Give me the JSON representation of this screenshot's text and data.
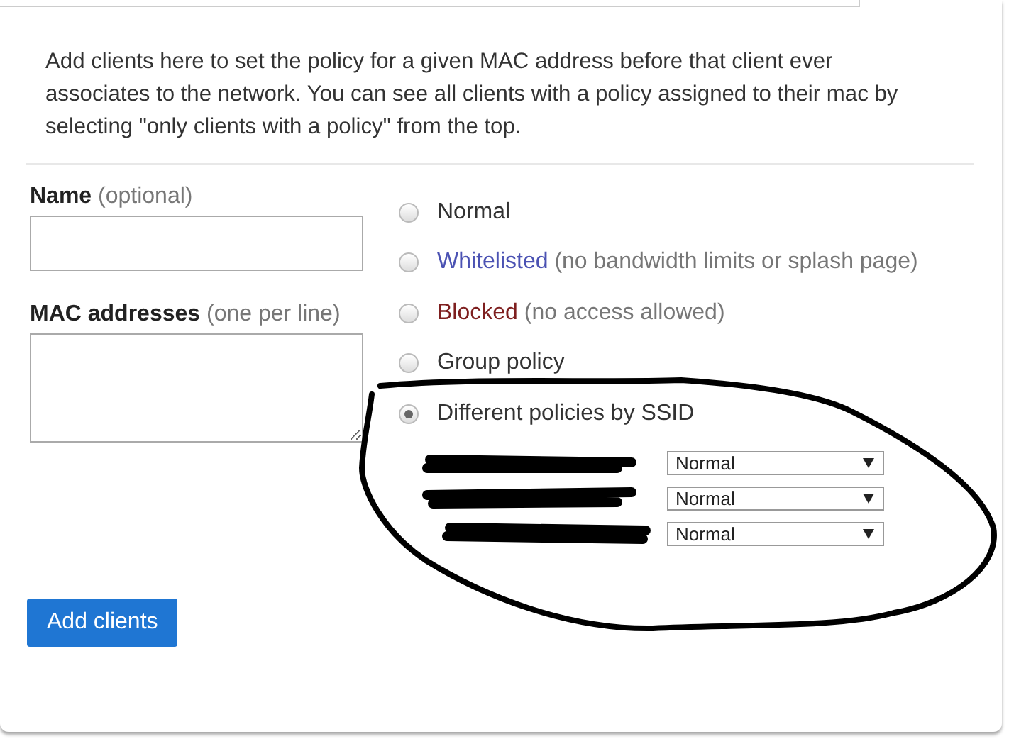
{
  "description": "Add clients here to set the policy for a given MAC address before that client ever associates to the network. You can see all clients with a policy assigned to their mac by selecting \"only clients with a policy\" from the top.",
  "name_field": {
    "label": "Name",
    "hint": "(optional)"
  },
  "mac_field": {
    "label": "MAC addresses",
    "hint": "(one per line)"
  },
  "policies": [
    {
      "label": "Normal",
      "selected": false
    },
    {
      "label": "Whitelisted",
      "note": "(no bandwidth limits or splash page)",
      "color": "#4b52b3",
      "selected": false
    },
    {
      "label": "Blocked",
      "note": "(no access allowed)",
      "color": "#7e1f1f",
      "selected": false
    },
    {
      "label": "Group policy",
      "selected": false
    },
    {
      "label": "Different policies by SSID",
      "selected": true
    }
  ],
  "ssid_policies": [
    {
      "value": "Normal"
    },
    {
      "value": "Normal"
    },
    {
      "value": "Normal"
    }
  ],
  "add_button": "Add clients"
}
